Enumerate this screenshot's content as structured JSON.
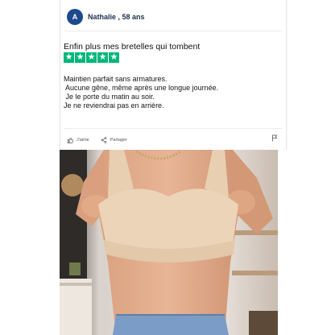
{
  "review": {
    "avatar_letter": "A",
    "author": "Nathalie , 58 ans",
    "title": "Enfin plus mes bretelles qui tombent",
    "rating": 5,
    "star_color": "#00b67a",
    "lines": [
      "Maintien parfait sans armatures.",
      " Aucune gêne, même après une longue journée.",
      " Je le porte du matin au soir.",
      "Je ne reviendrai pas en arrière."
    ],
    "actions": {
      "like_label": "J'aime",
      "share_label": "Partager"
    }
  },
  "photo": {
    "icon": "product-photo"
  },
  "colors": {
    "avatar": "#1c4a8c",
    "author": "#22324d"
  }
}
